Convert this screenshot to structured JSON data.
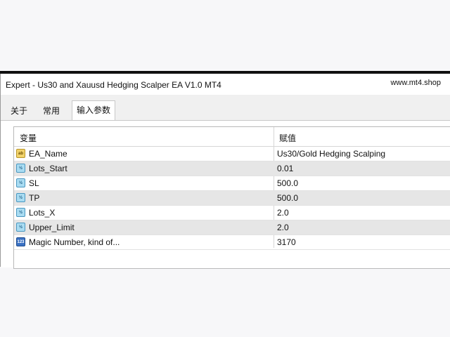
{
  "window": {
    "title": "Expert - Us30 and Xauusd Hedging Scalper EA V1.0 MT4",
    "site": "www.mt4.shop"
  },
  "tabs": [
    {
      "label": "关于",
      "active": false
    },
    {
      "label": "常用",
      "active": false
    },
    {
      "label": "输入参数",
      "active": true
    }
  ],
  "table": {
    "columns": {
      "variable": "变量",
      "value": "赋值"
    },
    "rows": [
      {
        "icon": "ab",
        "name": "EA_Name",
        "value": "Us30/Gold Hedging Scalping"
      },
      {
        "icon": "½",
        "name": "Lots_Start",
        "value": "0.01"
      },
      {
        "icon": "½",
        "name": "SL",
        "value": "500.0"
      },
      {
        "icon": "½",
        "name": "TP",
        "value": "500.0"
      },
      {
        "icon": "½",
        "name": "Lots_X",
        "value": "2.0"
      },
      {
        "icon": "½",
        "name": "Upper_Limit",
        "value": "2.0"
      },
      {
        "icon": "123",
        "name": "Magic Number, kind of...",
        "value": "3170"
      }
    ]
  }
}
